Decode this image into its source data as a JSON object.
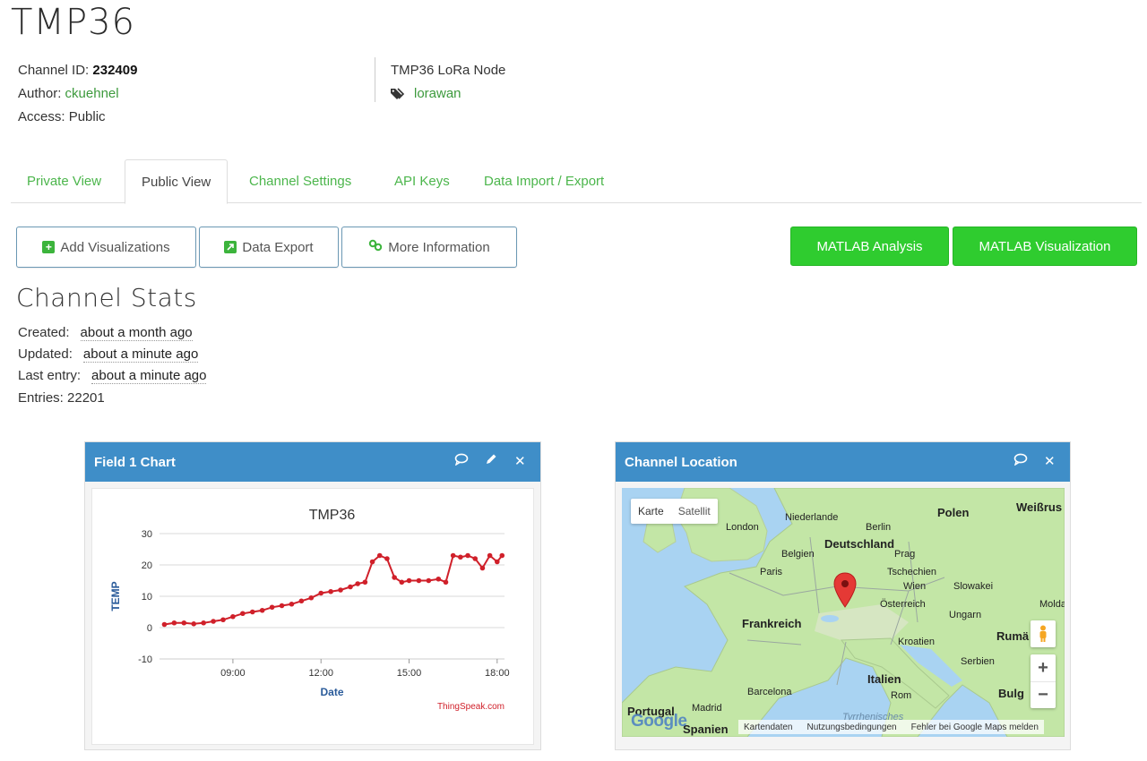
{
  "page": {
    "title": "TMP36"
  },
  "channel": {
    "id_label": "Channel ID:",
    "id_value": "232409",
    "author_label": "Author:",
    "author_value": "ckuehnel",
    "access_label": "Access:",
    "access_value": "Public",
    "description": "TMP36 LoRa Node",
    "tag": "lorawan"
  },
  "tabs": [
    {
      "label": "Private View"
    },
    {
      "label": "Public View"
    },
    {
      "label": "Channel Settings"
    },
    {
      "label": "API Keys"
    },
    {
      "label": "Data Import / Export"
    }
  ],
  "actions": {
    "add_visualizations": "Add Visualizations",
    "data_export": "Data Export",
    "more_information": "More Information",
    "matlab_analysis": "MATLAB Analysis",
    "matlab_visualization": "MATLAB Visualization"
  },
  "stats": {
    "title": "Channel Stats",
    "created_label": "Created:",
    "created_value": "about a month ago",
    "updated_label": "Updated:",
    "updated_value": "about a minute ago",
    "last_entry_label": "Last entry:",
    "last_entry_value": "about a minute ago",
    "entries_label": "Entries:",
    "entries_value": "22201"
  },
  "field_chart_widget": {
    "title": "Field 1 Chart",
    "credit": "ThingSpeak.com"
  },
  "location_widget": {
    "title": "Channel Location",
    "map_type_map": "Karte",
    "map_type_satellite": "Satellit",
    "zoom_in": "+",
    "zoom_out": "−",
    "footer_mapdata": "Kartendaten",
    "footer_terms": "Nutzungsbedingungen",
    "footer_report": "Fehler bei Google Maps melden",
    "google_logo": "Google",
    "labels": {
      "niederlande": "Niederlande",
      "london": "London",
      "berlin": "Berlin",
      "polen": "Polen",
      "weissrus": "Weißrus",
      "deutschland": "Deutschland",
      "belgien": "Belgien",
      "prag": "Prag",
      "tschechien": "Tschechien",
      "paris": "Paris",
      "wien": "Wien",
      "slowakei": "Slowakei",
      "oesterreich": "Österreich",
      "frankreich": "Frankreich",
      "ungarn": "Ungarn",
      "molda": "Molda",
      "kroatien": "Kroatien",
      "ruma": "Rumä",
      "serbien": "Serbien",
      "italien": "Italien",
      "madrid": "Madrid",
      "barcelona": "Barcelona",
      "rom": "Rom",
      "bulg": "Bulg",
      "portugal": "Portugal",
      "spanien": "Spanien",
      "tyrrhenisches": "Tyrrhenisches"
    }
  },
  "colors": {
    "accent_green": "#4cb64c",
    "button_green": "#2fcc2f",
    "widget_header_blue": "#3f8ec8",
    "series_red": "#d0202a",
    "axis_label_blue": "#2a5b9a"
  },
  "icons": {
    "tag": "tag-icon",
    "add": "plus-square-icon",
    "export": "external-link-icon",
    "info": "link-icon",
    "comment": "comment-icon",
    "edit": "pencil-icon",
    "close": "close-icon",
    "pegman": "pegman-icon",
    "marker": "map-marker-icon"
  },
  "chart_data": {
    "type": "line",
    "title": "TMP36",
    "xlabel": "Date",
    "ylabel": "TEMP",
    "ylim": [
      -10,
      30
    ],
    "yticks": [
      30,
      20,
      10,
      0,
      -10
    ],
    "xticks": [
      "09:00",
      "12:00",
      "15:00",
      "18:00"
    ],
    "xlim": [
      "06:30",
      "18:15"
    ],
    "grid": true,
    "series": [
      {
        "x": [
          "06:40",
          "07:00",
          "07:20",
          "07:40",
          "08:00",
          "08:20",
          "08:40",
          "09:00",
          "09:20",
          "09:40",
          "10:00",
          "10:20",
          "10:40",
          "11:00",
          "11:20",
          "11:40",
          "12:00",
          "12:20",
          "12:40",
          "13:00",
          "13:15",
          "13:30",
          "13:45",
          "14:00",
          "14:15",
          "14:30",
          "14:45",
          "15:00",
          "15:20",
          "15:40",
          "16:00",
          "16:15",
          "16:30",
          "16:45",
          "17:00",
          "17:15",
          "17:30",
          "17:45",
          "18:00",
          "18:10"
        ],
        "values": [
          1,
          1.5,
          1.5,
          1.2,
          1.5,
          2,
          2.5,
          3.5,
          4.5,
          5,
          5.5,
          6.5,
          7,
          7.5,
          8.5,
          9.5,
          11,
          11.5,
          12,
          13,
          14,
          14.5,
          21,
          23,
          22,
          16,
          14.5,
          15,
          15,
          15,
          15.5,
          14.5,
          23,
          22.5,
          23,
          22,
          19,
          23,
          21,
          23
        ]
      }
    ]
  }
}
